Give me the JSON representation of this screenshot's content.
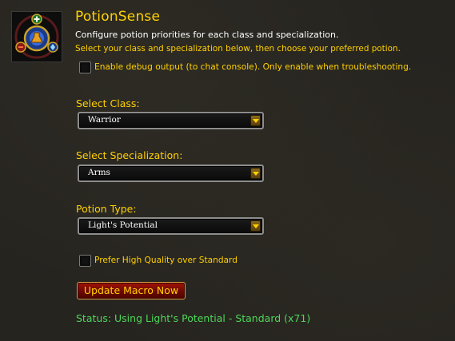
{
  "addon": {
    "icon": "potion-crest-icon",
    "title": "PotionSense",
    "subtitle": "Configure potion priorities for each class and specialization.",
    "instructions": "Select your class and specialization below, then choose your preferred potion."
  },
  "debug": {
    "checked": false,
    "label": "Enable debug output (to chat console). Only enable when troubleshooting."
  },
  "class_select": {
    "label": "Select Class:",
    "value": "Warrior"
  },
  "spec_select": {
    "label": "Select Specialization:",
    "value": "Arms"
  },
  "potion_select": {
    "label": "Potion Type:",
    "value": "Light's Potential"
  },
  "quality": {
    "checked": false,
    "label": "Prefer High Quality over Standard"
  },
  "macro_button": {
    "label": "Update Macro Now"
  },
  "status": {
    "text": "Status: Using Light's Potential - Standard (x71)"
  },
  "colors": {
    "gold": "#ffd100",
    "status_green": "#4dd75a",
    "button_red": "#8a0e04",
    "background": "#26241f"
  }
}
